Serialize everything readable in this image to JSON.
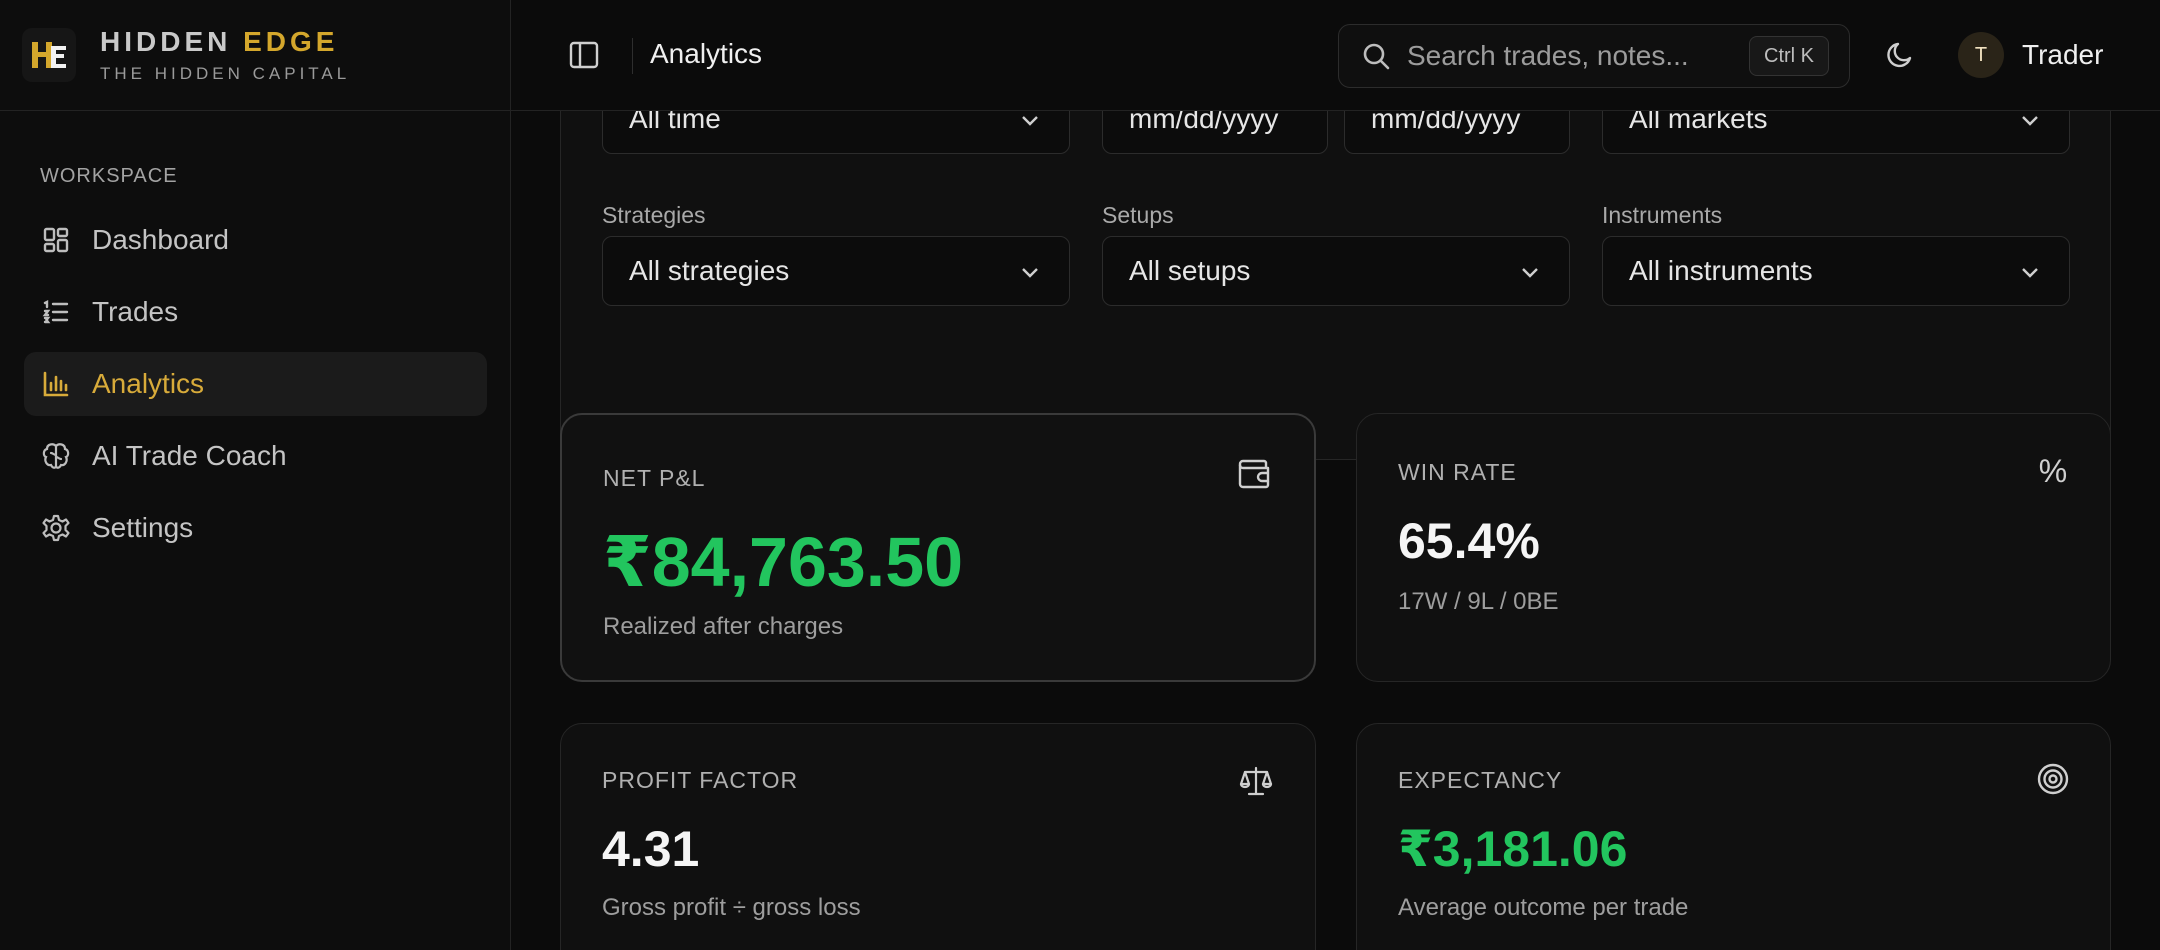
{
  "brand": {
    "name_part1": "HIDDEN ",
    "name_part2": "EDGE",
    "tagline": "THE HIDDEN CAPITAL",
    "logo_text": "HE"
  },
  "sidebar": {
    "section": "WORKSPACE",
    "items": [
      {
        "label": "Dashboard",
        "icon": "dashboard-icon",
        "active": false
      },
      {
        "label": "Trades",
        "icon": "list-icon",
        "active": false
      },
      {
        "label": "Analytics",
        "icon": "bar-chart-icon",
        "active": true
      },
      {
        "label": "AI Trade Coach",
        "icon": "brain-icon",
        "active": false
      },
      {
        "label": "Settings",
        "icon": "gear-icon",
        "active": false
      }
    ]
  },
  "topbar": {
    "title": "Analytics",
    "search_placeholder": "Search trades, notes...",
    "shortcut": "Ctrl K",
    "user_initial": "T",
    "user_name": "Trader"
  },
  "filters": {
    "period": "All time",
    "date_from_placeholder": "mm/dd/yyyy",
    "date_to_placeholder": "mm/dd/yyyy",
    "markets": "All markets",
    "strategies_label": "Strategies",
    "strategies_value": "All strategies",
    "setups_label": "Setups",
    "setups_value": "All setups",
    "instruments_label": "Instruments",
    "instruments_value": "All instruments"
  },
  "metrics": {
    "net_pl": {
      "title": "NET P&L",
      "value": "₹84,763.50",
      "sub": "Realized after charges"
    },
    "win_rate": {
      "title": "WIN RATE",
      "value": "65.4%",
      "sub": "17W / 9L / 0BE",
      "icon_glyph": "%"
    },
    "profit_factor": {
      "title": "PROFIT FACTOR",
      "value": "4.31",
      "sub": "Gross profit ÷ gross loss"
    },
    "expectancy": {
      "title": "EXPECTANCY",
      "value": "₹3,181.06",
      "sub": "Average outcome per trade"
    }
  },
  "colors": {
    "accent": "#d4a72c",
    "positive": "#22c55e",
    "background": "#0b0b0b"
  }
}
